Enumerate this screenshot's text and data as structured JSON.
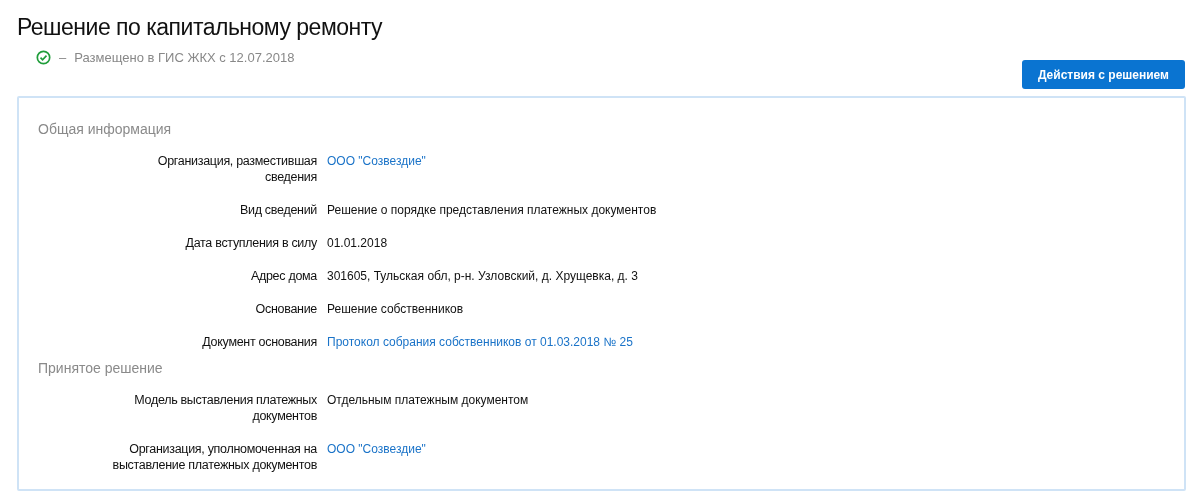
{
  "title": "Решение по капитальному ремонту",
  "status": {
    "separator": "–",
    "text": "Размещено в ГИС ЖКХ с 12.07.2018"
  },
  "actions_button": "Действия с решением",
  "sections": [
    {
      "heading": "Общая информация",
      "fields": [
        {
          "label": "Организация, разместившая сведения",
          "value": "ООО \"Созвездие\"",
          "kind": "link"
        },
        {
          "label": "Вид сведений",
          "value": "Решение о порядке представления платежных документов",
          "kind": "text"
        },
        {
          "label": "Дата вступления в силу",
          "value": "01.01.2018",
          "kind": "text"
        },
        {
          "label": "Адрес дома",
          "value": "301605, Тульская обл, р-н. Узловский, д. Хрущевка, д. 3",
          "kind": "text"
        },
        {
          "label": "Основание",
          "value": "Решение собственников",
          "kind": "text"
        },
        {
          "label": "Документ основания",
          "value": "Протокол собрания собственников от 01.03.2018 № 25",
          "kind": "link"
        }
      ]
    },
    {
      "heading": "Принятое решение",
      "fields": [
        {
          "label": "Модель выставления платежных документов",
          "value": "Отдельным платежным документом",
          "kind": "text"
        },
        {
          "label": "Организация, уполномоченная на выставление платежных документов",
          "value": "ООО \"Созвездие\"",
          "kind": "link"
        }
      ]
    }
  ]
}
